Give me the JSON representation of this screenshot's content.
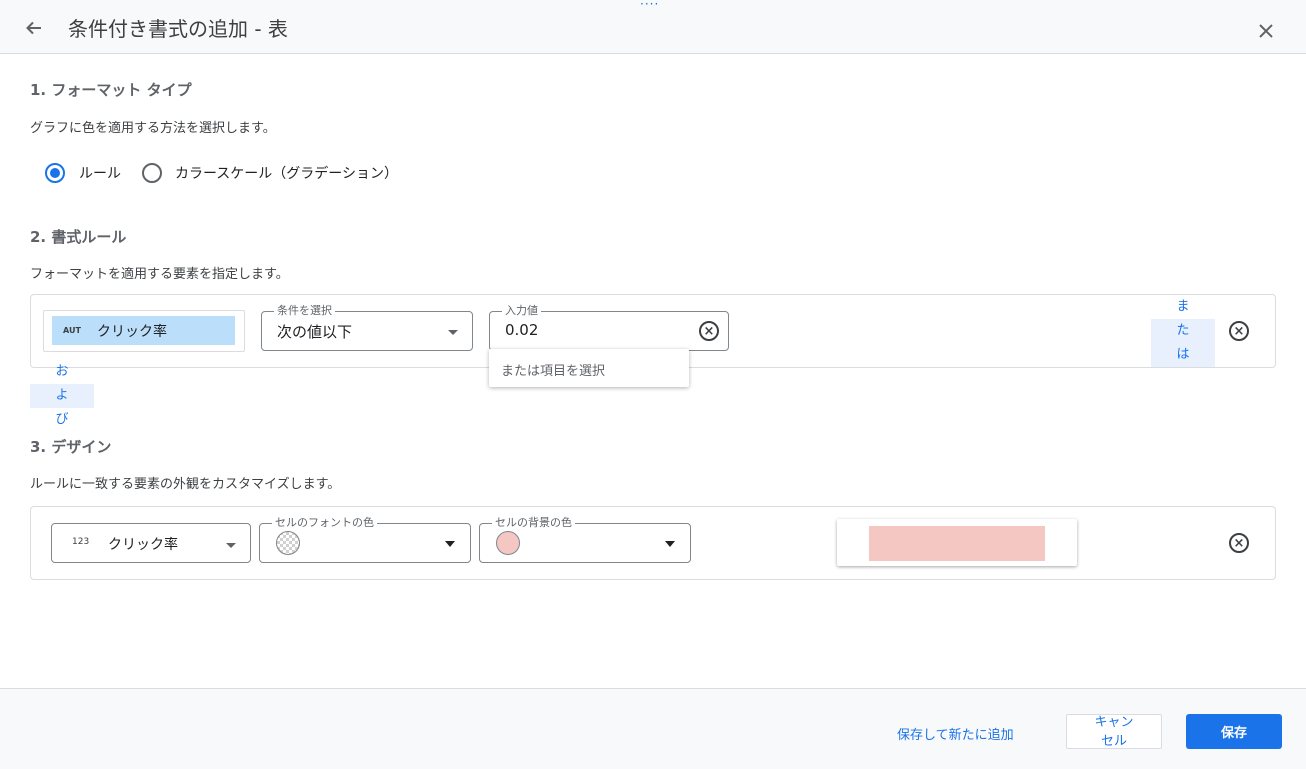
{
  "header": {
    "title": "条件付き書式の追加 - 表",
    "drag_handle": "····"
  },
  "section1": {
    "title": "1. フォーマット タイプ",
    "description": "グラフに色を適用する方法を選択します。",
    "options": [
      {
        "label": "ルール",
        "selected": true
      },
      {
        "label": "カラースケール（グラデーション）",
        "selected": false
      }
    ]
  },
  "section2": {
    "title": "2. 書式ルール",
    "description": "フォーマットを適用する要素を指定します。",
    "rule": {
      "metric_badge": "AUT",
      "metric": "クリック率",
      "condition_label": "条件を選択",
      "condition_value": "次の値以下",
      "input_label": "入力値",
      "input_value": "0.02",
      "dropdown_option": "または項目を選択",
      "or_button": [
        "ま",
        "た",
        "は"
      ]
    },
    "and_button": [
      "お",
      "よ",
      "び"
    ]
  },
  "section3": {
    "title": "3. デザイン",
    "description": "ルールに一致する要素の外観をカスタマイズします。",
    "design": {
      "field_badge": "123",
      "field_value": "クリック率",
      "font_color_label": "セルのフォントの色",
      "bg_color_label": "セルの背景の色",
      "bg_color": "#f4c7c3",
      "preview_color": "#f4c7c3"
    }
  },
  "footer": {
    "save_and_add": "保存して新たに追加",
    "cancel_lines": [
      "キャン",
      "セル"
    ],
    "save": "保存"
  },
  "colors": {
    "accent": "#1a73e8",
    "chip_bg": "#bbdefb",
    "pink": "#f4c7c3"
  },
  "icons": [
    "back-arrow-icon",
    "close-icon",
    "clear-icon",
    "dropdown-caret-icon",
    "transparent-color-icon"
  ]
}
